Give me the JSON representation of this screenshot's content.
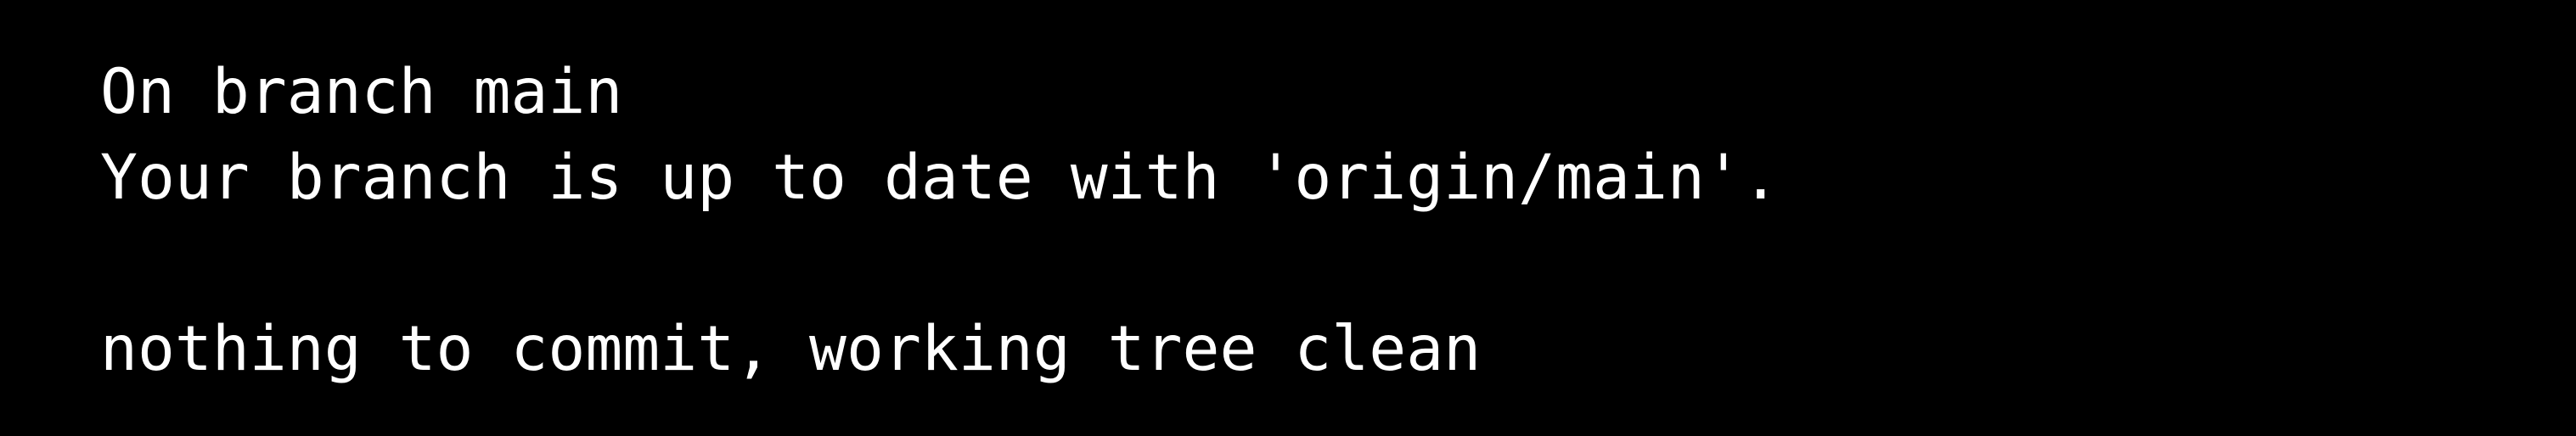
{
  "terminal": {
    "lines": [
      "On branch main",
      "Your branch is up to date with 'origin/main'.",
      "",
      "nothing to commit, working tree clean"
    ]
  },
  "colors": {
    "background": "#000000",
    "foreground": "#ffffff"
  }
}
